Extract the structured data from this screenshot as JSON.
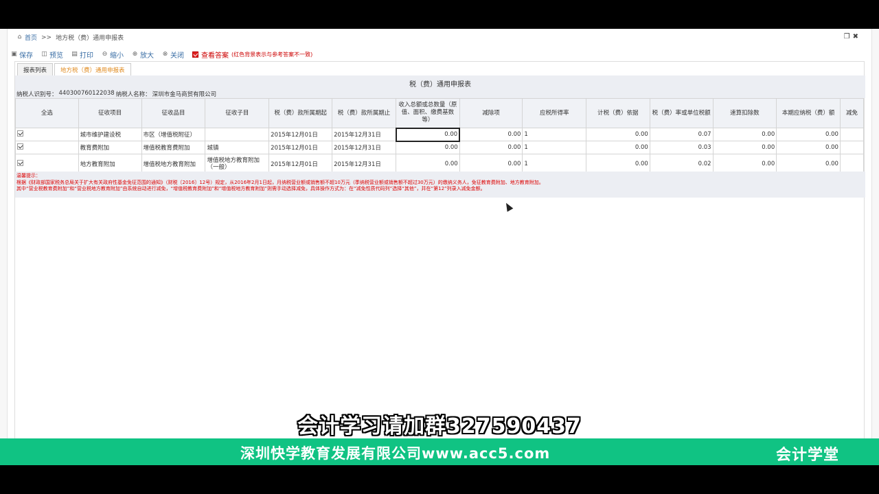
{
  "breadcrumb": {
    "home": "首页",
    "sep": ">>",
    "current": "地方税（费）通用申报表"
  },
  "window_buttons": {
    "restore": "❐",
    "close": "✖"
  },
  "toolbar": [
    {
      "label": "保存",
      "icon": "save-icon"
    },
    {
      "label": "预览",
      "icon": "preview-icon"
    },
    {
      "label": "打印",
      "icon": "print-icon"
    },
    {
      "label": "缩小",
      "icon": "zoom-out-icon"
    },
    {
      "label": "放大",
      "icon": "zoom-in-icon"
    },
    {
      "label": "关闭",
      "icon": "close-icon"
    }
  ],
  "answer_toggle": {
    "label": "查看答案",
    "note": "(红色背景表示与参考答案不一致)",
    "checked": true
  },
  "tabs": [
    {
      "label": "报表列表",
      "active": false
    },
    {
      "label": "地方税（费）通用申报表",
      "active": true
    }
  ],
  "form": {
    "title": "税（费）通用申报表",
    "taxpayer_id_label": "纳税人识别号：",
    "taxpayer_id": "440300760122038",
    "taxpayer_name_label": "纳税人名称：",
    "taxpayer_name": "深圳市金马商贸有限公司"
  },
  "table": {
    "headers": [
      "全选",
      "征收项目",
      "征收品目",
      "征收子目",
      "税（费）款所属期起",
      "税（费）款所属期止",
      "收入总额或总数量（原值、面积、缴费基数等）",
      "减除项",
      "应税所得率",
      "计税（费）依据",
      "税（费）率或单位税额",
      "速算扣除数",
      "本期应纳税（费）额",
      "减免"
    ],
    "rows": [
      {
        "checked": true,
        "item": "城市维护建设税",
        "category": "市区（增值税附征）",
        "sub": "",
        "start": "2015年12月01日",
        "end": "2015年12月31日",
        "income": "0.00",
        "deduction": "0.00",
        "rate_income": "1",
        "basis": "0.00",
        "rate": "0.07",
        "quick": "0.00",
        "payable": "0.00"
      },
      {
        "checked": true,
        "item": "教育费附加",
        "category": "增值税教育费附加",
        "sub": "城镇",
        "start": "2015年12月01日",
        "end": "2015年12月31日",
        "income": "0.00",
        "deduction": "0.00",
        "rate_income": "1",
        "basis": "0.00",
        "rate": "0.03",
        "quick": "0.00",
        "payable": "0.00"
      },
      {
        "checked": true,
        "item": "地方教育附加",
        "category": "增值税地方教育附加",
        "sub": "增值税地方教育附加（一般）",
        "start": "2015年12月01日",
        "end": "2015年12月31日",
        "income": "0.00",
        "deduction": "0.00",
        "rate_income": "1",
        "basis": "0.00",
        "rate": "0.02",
        "quick": "0.00",
        "payable": "0.00"
      }
    ]
  },
  "notice": {
    "title": "温馨提示：",
    "line1": "根据《财政部国家税务总局关于扩大有关政府性基金免征范围的通知》（财税〔2016〕12号）规定，从2016年2月1日起，月纳税营业额或销售额不超10万元（季纳税营业额或销售额不超过30万元）的缴纳义务人，免征教育费附加、地方教育附加。",
    "line2": "其中“营业税教育费附加”和“营业税地方教育附加”由系统自动进行减免，“增值税教育费附加”和“增值税地方教育附加”则需手动选择减免，具体操作方式为：在“减免性质代码列”选择“其他”，并在“第12”列录入减免金额。"
  },
  "overlay": {
    "watermark": "会计学习请加群327590437",
    "company": "深圳快学教育发展有限公司www.acc5.com",
    "brand": "会计学堂"
  }
}
